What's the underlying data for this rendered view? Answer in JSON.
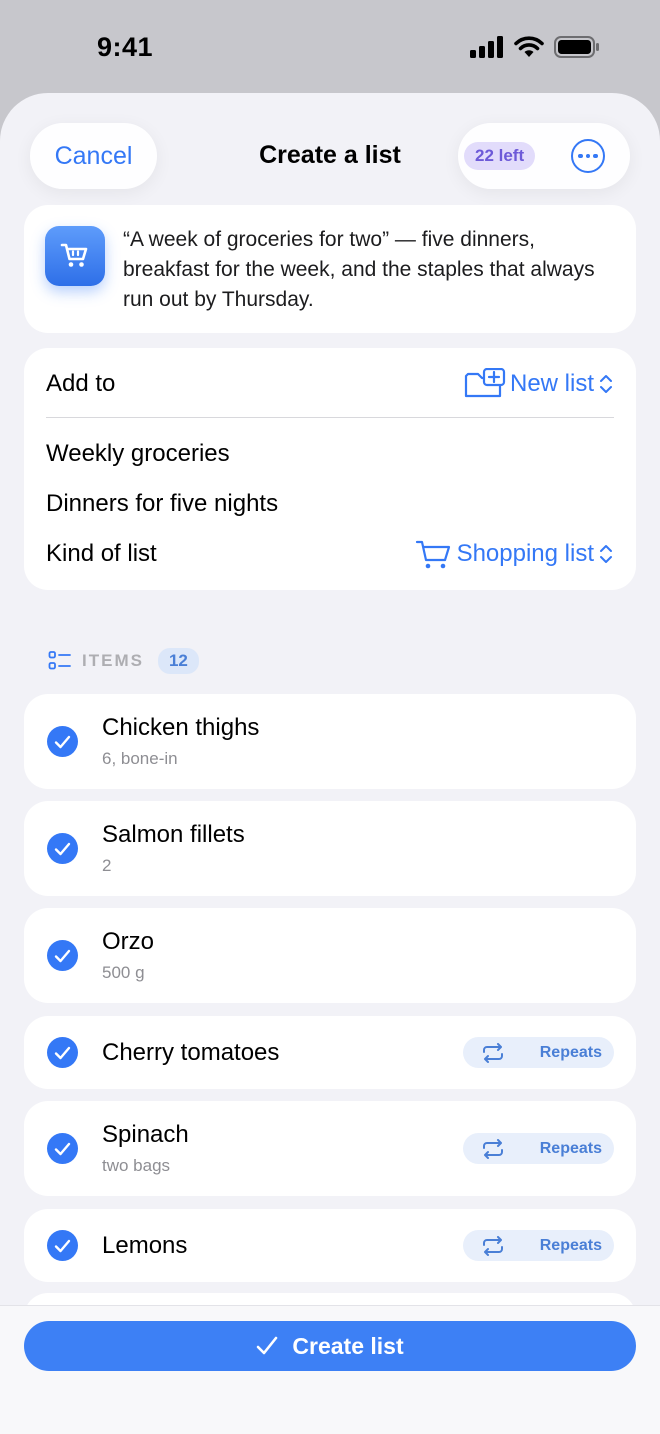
{
  "status": {
    "time": "9:41"
  },
  "header": {
    "cancel_label": "Cancel",
    "title": "Create a list",
    "remaining_badge": "22 left",
    "more_icon": "ellipsis-circle-icon"
  },
  "prompt": {
    "icon": "cart-icon",
    "text": "“A week of groceries for two” — five dinners, breakfast for the week, and the staples that always run out by Thursday."
  },
  "form": {
    "add_to_label": "Add to",
    "add_to_value": "New list",
    "line1": "Weekly groceries",
    "line2": "Dinners for five nights",
    "kind_label": "Kind of list",
    "kind_value": "Shopping list"
  },
  "items_section": {
    "label": "ITEMS",
    "count": "12"
  },
  "items": [
    {
      "title": "Chicken thighs",
      "subtitle": "6, bone-in",
      "checked": true
    },
    {
      "title": "Salmon fillets",
      "subtitle": "2",
      "checked": true
    },
    {
      "title": "Orzo",
      "subtitle": "500 g",
      "checked": true
    },
    {
      "title": "Cherry tomatoes",
      "subtitle": "",
      "checked": true,
      "tag": "Repeats"
    },
    {
      "title": "Spinach",
      "subtitle": "two bags",
      "checked": true,
      "tag": "Repeats"
    },
    {
      "title": "Lemons",
      "subtitle": "",
      "checked": true,
      "tag": "Repeats"
    }
  ],
  "footer": {
    "create_label": "Create list"
  },
  "colors": {
    "accent": "#3478f6",
    "badge_purple": "#6d5ad8"
  }
}
